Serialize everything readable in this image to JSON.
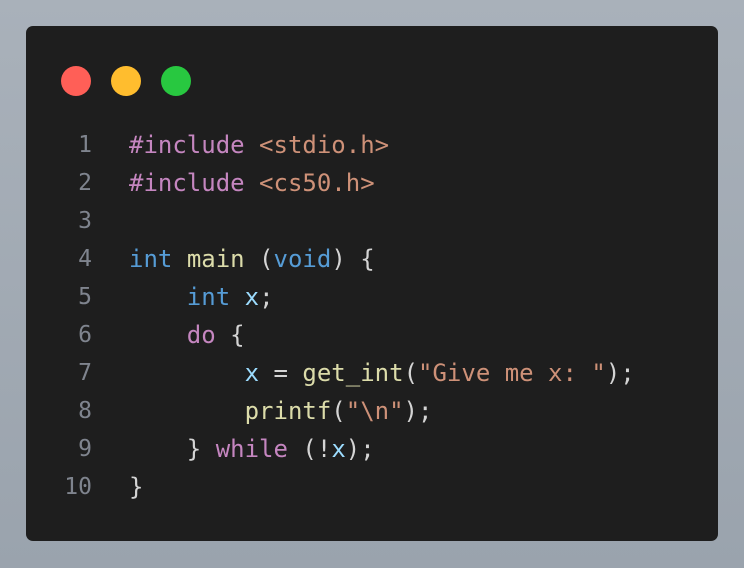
{
  "colors": {
    "close": "#ff5f57",
    "minimize": "#ffbd2e",
    "maximize": "#28c840",
    "background": "#1e1e1e"
  },
  "lines": [
    {
      "number": "1",
      "tokens": [
        {
          "t": "#include",
          "c": "kw-pre"
        },
        {
          "t": " ",
          "c": "punc"
        },
        {
          "t": "<stdio.h>",
          "c": "str"
        }
      ]
    },
    {
      "number": "2",
      "tokens": [
        {
          "t": "#include",
          "c": "kw-pre"
        },
        {
          "t": " ",
          "c": "punc"
        },
        {
          "t": "<cs50.h>",
          "c": "str"
        }
      ]
    },
    {
      "number": "3",
      "tokens": []
    },
    {
      "number": "4",
      "tokens": [
        {
          "t": "int",
          "c": "type"
        },
        {
          "t": " ",
          "c": "punc"
        },
        {
          "t": "main",
          "c": "fn"
        },
        {
          "t": " (",
          "c": "punc"
        },
        {
          "t": "void",
          "c": "type"
        },
        {
          "t": ") {",
          "c": "punc"
        }
      ]
    },
    {
      "number": "5",
      "tokens": [
        {
          "t": "    ",
          "c": "punc"
        },
        {
          "t": "int",
          "c": "type"
        },
        {
          "t": " ",
          "c": "punc"
        },
        {
          "t": "x",
          "c": "var"
        },
        {
          "t": ";",
          "c": "punc"
        }
      ]
    },
    {
      "number": "6",
      "tokens": [
        {
          "t": "    ",
          "c": "punc"
        },
        {
          "t": "do",
          "c": "ctrl"
        },
        {
          "t": " {",
          "c": "punc"
        }
      ]
    },
    {
      "number": "7",
      "tokens": [
        {
          "t": "        ",
          "c": "punc"
        },
        {
          "t": "x",
          "c": "var"
        },
        {
          "t": " = ",
          "c": "punc"
        },
        {
          "t": "get_int",
          "c": "fn"
        },
        {
          "t": "(",
          "c": "punc"
        },
        {
          "t": "\"Give me x: \"",
          "c": "str"
        },
        {
          "t": ");",
          "c": "punc"
        }
      ]
    },
    {
      "number": "8",
      "tokens": [
        {
          "t": "        ",
          "c": "punc"
        },
        {
          "t": "printf",
          "c": "fn"
        },
        {
          "t": "(",
          "c": "punc"
        },
        {
          "t": "\"\\n\"",
          "c": "str"
        },
        {
          "t": ");",
          "c": "punc"
        }
      ]
    },
    {
      "number": "9",
      "tokens": [
        {
          "t": "    ",
          "c": "punc"
        },
        {
          "t": "} ",
          "c": "punc"
        },
        {
          "t": "while",
          "c": "ctrl"
        },
        {
          "t": " (!",
          "c": "punc"
        },
        {
          "t": "x",
          "c": "var"
        },
        {
          "t": ");",
          "c": "punc"
        }
      ]
    },
    {
      "number": "10",
      "tokens": [
        {
          "t": "}",
          "c": "punc"
        }
      ]
    }
  ]
}
